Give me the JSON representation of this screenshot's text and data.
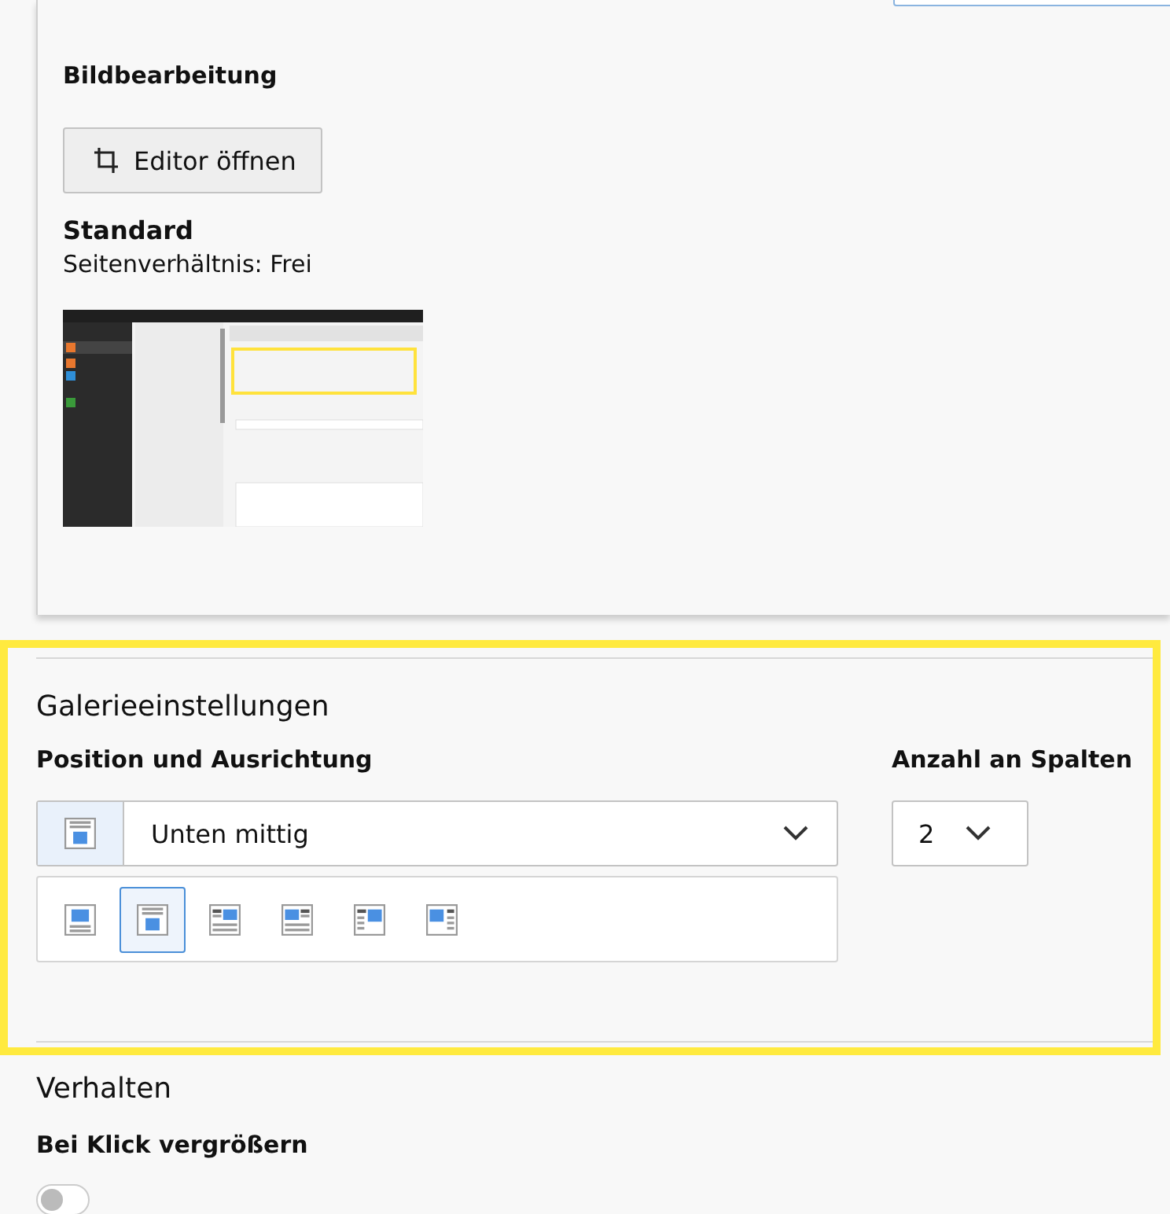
{
  "image_editing": {
    "heading": "Bildbearbeitung",
    "editor_button": "Editor öffnen",
    "crop_variant": "Standard",
    "aspect_ratio": "Seitenverhältnis: Frei"
  },
  "gallery": {
    "heading": "Galerieeinstellungen",
    "position": {
      "label": "Position und Ausrichtung",
      "value": "Unten mittig",
      "options": [
        {
          "kind": "above",
          "selected": false
        },
        {
          "kind": "below",
          "selected": true
        },
        {
          "kind": "intext-right",
          "selected": false
        },
        {
          "kind": "intext-left",
          "selected": false
        },
        {
          "kind": "beside-right",
          "selected": false
        },
        {
          "kind": "beside-left",
          "selected": false
        }
      ]
    },
    "columns": {
      "label": "Anzahl an Spalten",
      "value": "2"
    }
  },
  "behavior": {
    "heading": "Verhalten",
    "enlarge": {
      "label": "Bei Klick vergrößern",
      "on": false
    }
  }
}
